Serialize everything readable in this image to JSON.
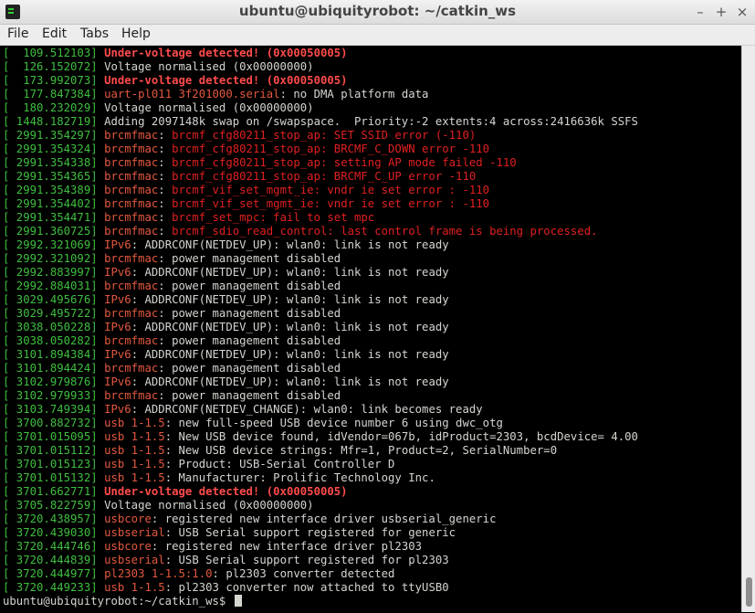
{
  "window": {
    "title": "ubuntu@ubiquityrobot: ~/catkin_ws",
    "minimize": "–",
    "maximize": "+",
    "close": "×"
  },
  "menu": [
    "File",
    "Edit",
    "Tabs",
    "Help"
  ],
  "colors": {
    "timestamp": "#3fbf3f",
    "facility": "#e4583f",
    "error": "#e02020",
    "warning": "#ff4b4b",
    "text": "#d3d7cf"
  },
  "lines": [
    {
      "ts": "[  109.512103]",
      "fac": "",
      "sep": "",
      "msg": "Under-voltage detected! (0x00050005)",
      "cls": "warn"
    },
    {
      "ts": "[  126.152072]",
      "fac": "",
      "sep": "",
      "msg": "Voltage normalised (0x00000000)",
      "cls": "msg"
    },
    {
      "ts": "[  173.992073]",
      "fac": "",
      "sep": "",
      "msg": "Under-voltage detected! (0x00050005)",
      "cls": "warn"
    },
    {
      "ts": "[  177.847384]",
      "fac": "uart-pl011 3f201000.serial",
      "sep": ": ",
      "msg": "no DMA platform data",
      "cls": "msg"
    },
    {
      "ts": "[  180.232029]",
      "fac": "",
      "sep": "",
      "msg": "Voltage normalised (0x00000000)",
      "cls": "msg"
    },
    {
      "ts": "[ 1448.182719]",
      "fac": "",
      "sep": "",
      "msg": "Adding 2097148k swap on /swapspace.  Priority:-2 extents:4 across:2416636k SSFS",
      "cls": "msg"
    },
    {
      "ts": "[ 2991.354297]",
      "fac": "brcmfmac",
      "sep": ": ",
      "msg": "brcmf_cfg80211_stop_ap: SET SSID error (-110)",
      "cls": "err"
    },
    {
      "ts": "[ 2991.354324]",
      "fac": "brcmfmac",
      "sep": ": ",
      "msg": "brcmf_cfg80211_stop_ap: BRCMF_C_DOWN error -110",
      "cls": "err"
    },
    {
      "ts": "[ 2991.354338]",
      "fac": "brcmfmac",
      "sep": ": ",
      "msg": "brcmf_cfg80211_stop_ap: setting AP mode failed -110",
      "cls": "err"
    },
    {
      "ts": "[ 2991.354365]",
      "fac": "brcmfmac",
      "sep": ": ",
      "msg": "brcmf_cfg80211_stop_ap: BRCMF_C_UP error -110",
      "cls": "err"
    },
    {
      "ts": "[ 2991.354389]",
      "fac": "brcmfmac",
      "sep": ": ",
      "msg": "brcmf_vif_set_mgmt_ie: vndr ie set error : -110",
      "cls": "err"
    },
    {
      "ts": "[ 2991.354402]",
      "fac": "brcmfmac",
      "sep": ": ",
      "msg": "brcmf_vif_set_mgmt_ie: vndr ie set error : -110",
      "cls": "err"
    },
    {
      "ts": "[ 2991.354471]",
      "fac": "brcmfmac",
      "sep": ": ",
      "msg": "brcmf_set_mpc: fail to set mpc",
      "cls": "err"
    },
    {
      "ts": "[ 2991.360725]",
      "fac": "brcmfmac",
      "sep": ": ",
      "msg": "brcmf_sdio_read_control: last control frame is being processed.",
      "cls": "err"
    },
    {
      "ts": "[ 2992.321069]",
      "fac": "IPv6",
      "sep": ": ",
      "msg": "ADDRCONF(NETDEV_UP): wlan0: link is not ready",
      "cls": "msg"
    },
    {
      "ts": "[ 2992.321092]",
      "fac": "brcmfmac",
      "sep": ": ",
      "msg": "power management disabled",
      "cls": "msg"
    },
    {
      "ts": "[ 2992.883997]",
      "fac": "IPv6",
      "sep": ": ",
      "msg": "ADDRCONF(NETDEV_UP): wlan0: link is not ready",
      "cls": "msg"
    },
    {
      "ts": "[ 2992.884031]",
      "fac": "brcmfmac",
      "sep": ": ",
      "msg": "power management disabled",
      "cls": "msg"
    },
    {
      "ts": "[ 3029.495676]",
      "fac": "IPv6",
      "sep": ": ",
      "msg": "ADDRCONF(NETDEV_UP): wlan0: link is not ready",
      "cls": "msg"
    },
    {
      "ts": "[ 3029.495722]",
      "fac": "brcmfmac",
      "sep": ": ",
      "msg": "power management disabled",
      "cls": "msg"
    },
    {
      "ts": "[ 3038.050228]",
      "fac": "IPv6",
      "sep": ": ",
      "msg": "ADDRCONF(NETDEV_UP): wlan0: link is not ready",
      "cls": "msg"
    },
    {
      "ts": "[ 3038.050282]",
      "fac": "brcmfmac",
      "sep": ": ",
      "msg": "power management disabled",
      "cls": "msg"
    },
    {
      "ts": "[ 3101.894384]",
      "fac": "IPv6",
      "sep": ": ",
      "msg": "ADDRCONF(NETDEV_UP): wlan0: link is not ready",
      "cls": "msg"
    },
    {
      "ts": "[ 3101.894424]",
      "fac": "brcmfmac",
      "sep": ": ",
      "msg": "power management disabled",
      "cls": "msg"
    },
    {
      "ts": "[ 3102.979876]",
      "fac": "IPv6",
      "sep": ": ",
      "msg": "ADDRCONF(NETDEV_UP): wlan0: link is not ready",
      "cls": "msg"
    },
    {
      "ts": "[ 3102.979933]",
      "fac": "brcmfmac",
      "sep": ": ",
      "msg": "power management disabled",
      "cls": "msg"
    },
    {
      "ts": "[ 3103.749394]",
      "fac": "IPv6",
      "sep": ": ",
      "msg": "ADDRCONF(NETDEV_CHANGE): wlan0: link becomes ready",
      "cls": "msg"
    },
    {
      "ts": "[ 3700.882732]",
      "fac": "usb 1-1.5",
      "sep": ": ",
      "msg": "new full-speed USB device number 6 using dwc_otg",
      "cls": "msg"
    },
    {
      "ts": "[ 3701.015095]",
      "fac": "usb 1-1.5",
      "sep": ": ",
      "msg": "New USB device found, idVendor=067b, idProduct=2303, bcdDevice= 4.00",
      "cls": "msg"
    },
    {
      "ts": "[ 3701.015112]",
      "fac": "usb 1-1.5",
      "sep": ": ",
      "msg": "New USB device strings: Mfr=1, Product=2, SerialNumber=0",
      "cls": "msg"
    },
    {
      "ts": "[ 3701.015123]",
      "fac": "usb 1-1.5",
      "sep": ": ",
      "msg": "Product: USB-Serial Controller D",
      "cls": "msg"
    },
    {
      "ts": "[ 3701.015132]",
      "fac": "usb 1-1.5",
      "sep": ": ",
      "msg": "Manufacturer: Prolific Technology Inc.",
      "cls": "msg"
    },
    {
      "ts": "[ 3701.662771]",
      "fac": "",
      "sep": "",
      "msg": "Under-voltage detected! (0x00050005)",
      "cls": "warn"
    },
    {
      "ts": "[ 3705.822759]",
      "fac": "",
      "sep": "",
      "msg": "Voltage normalised (0x00000000)",
      "cls": "msg"
    },
    {
      "ts": "[ 3720.438957]",
      "fac": "usbcore",
      "sep": ": ",
      "msg": "registered new interface driver usbserial_generic",
      "cls": "msg"
    },
    {
      "ts": "[ 3720.439030]",
      "fac": "usbserial",
      "sep": ": ",
      "msg": "USB Serial support registered for generic",
      "cls": "msg"
    },
    {
      "ts": "[ 3720.444746]",
      "fac": "usbcore",
      "sep": ": ",
      "msg": "registered new interface driver pl2303",
      "cls": "msg"
    },
    {
      "ts": "[ 3720.444839]",
      "fac": "usbserial",
      "sep": ": ",
      "msg": "USB Serial support registered for pl2303",
      "cls": "msg"
    },
    {
      "ts": "[ 3720.444977]",
      "fac": "pl2303 1-1.5:1.0",
      "sep": ": ",
      "msg": "pl2303 converter detected",
      "cls": "msg"
    },
    {
      "ts": "[ 3720.449233]",
      "fac": "usb 1-1.5",
      "sep": ": ",
      "msg": "pl2303 converter now attached to ttyUSB0",
      "cls": "msg"
    }
  ],
  "prompt": "ubuntu@ubiquityrobot:~/catkin_ws$ "
}
